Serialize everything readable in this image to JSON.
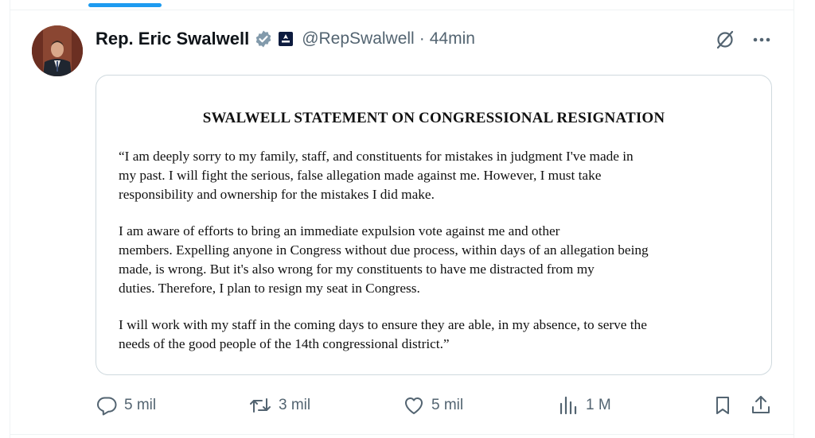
{
  "author": {
    "display_name": "Rep. Eric Swalwell",
    "handle": "@RepSwalwell",
    "separator": "·",
    "timestamp": "44min"
  },
  "icons": {
    "verified": "verified-badge-icon",
    "government": "government-affiliation-icon",
    "grok": "grok-icon",
    "more": "more-icon",
    "reply": "reply-icon",
    "repost": "repost-icon",
    "like": "like-icon",
    "views": "views-icon",
    "bookmark": "bookmark-icon",
    "share": "share-icon"
  },
  "colors": {
    "accent": "#1d9bf0",
    "secondary_text": "#536471",
    "verified_badge": "#829aab"
  },
  "statement": {
    "title": "SWALWELL STATEMENT ON CONGRESSIONAL RESIGNATION",
    "paragraph1": [
      "“I am deeply sorry to my family, staff, and constituents for mistakes in judgment I've made in",
      "my past.  I will fight the serious, false allegation made against me. However, I must take",
      "responsibility and ownership for the mistakes I did make."
    ],
    "paragraph2": [
      "I am aware of efforts to bring an immediate expulsion vote against me and other",
      "members.  Expelling anyone in Congress without due process, within days of an allegation being",
      "made, is wrong.  But it's also wrong for my constituents to have me distracted from my",
      "duties.  Therefore, I plan to resign my seat in Congress."
    ],
    "paragraph3": [
      "I will work with my staff in the coming days to ensure they are able, in my absence, to serve the",
      "needs of the good people of the 14th congressional district.”"
    ]
  },
  "actions": {
    "replies": "5 mil",
    "reposts": "3 mil",
    "likes": "5 mil",
    "views": "1 M"
  }
}
